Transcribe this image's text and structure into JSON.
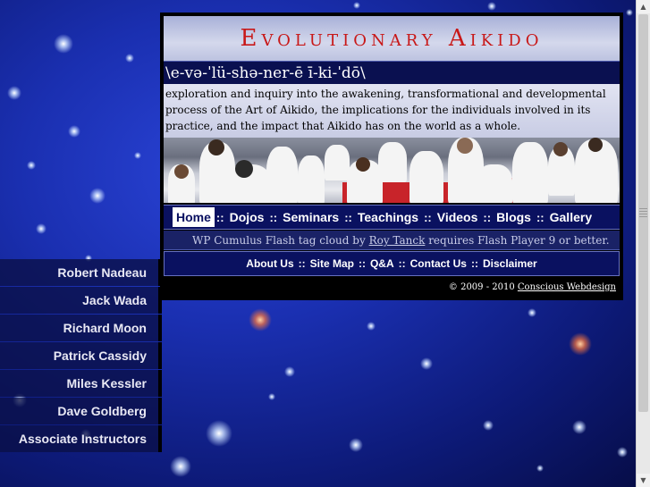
{
  "site": {
    "title": "Evolutionary Aikido",
    "pronunciation": "\\e-və-ˈlü-shə-ner-ē ī-ki-ˈdō\\",
    "description": "exploration and inquiry into the awakening, transformational and developmental process of the Art of Aikido, the implications for the individuals involved in its practice, and the impact that Aikido has on the world as a whole."
  },
  "main_nav": {
    "items": [
      {
        "label": "Home",
        "active": true
      },
      {
        "label": "Dojos"
      },
      {
        "label": "Seminars"
      },
      {
        "label": "Teachings"
      },
      {
        "label": "Videos"
      },
      {
        "label": "Blogs"
      },
      {
        "label": "Gallery"
      }
    ],
    "separator": "::"
  },
  "tag_cloud": {
    "prefix": "WP Cumulus Flash tag cloud by ",
    "author_link": "Roy Tanck",
    "suffix": " requires Flash Player 9 or better."
  },
  "secondary_nav": {
    "items": [
      "About Us",
      "Site Map",
      "Q&A",
      "Contact Us",
      "Disclaimer"
    ],
    "separator": "::"
  },
  "footer": {
    "copyright": "© 2009 - 2010 ",
    "credit_link": "Conscious Webdesign"
  },
  "sidebar": {
    "items": [
      "Robert Nadeau",
      "Jack Wada",
      "Richard Moon",
      "Patrick Cassidy",
      "Miles Kessler",
      "Dave Goldberg",
      "Associate Instructors"
    ]
  },
  "colors": {
    "title_red": "#c81818",
    "nav_blue": "#0a1160",
    "background_blue": "#1a2fb0"
  }
}
